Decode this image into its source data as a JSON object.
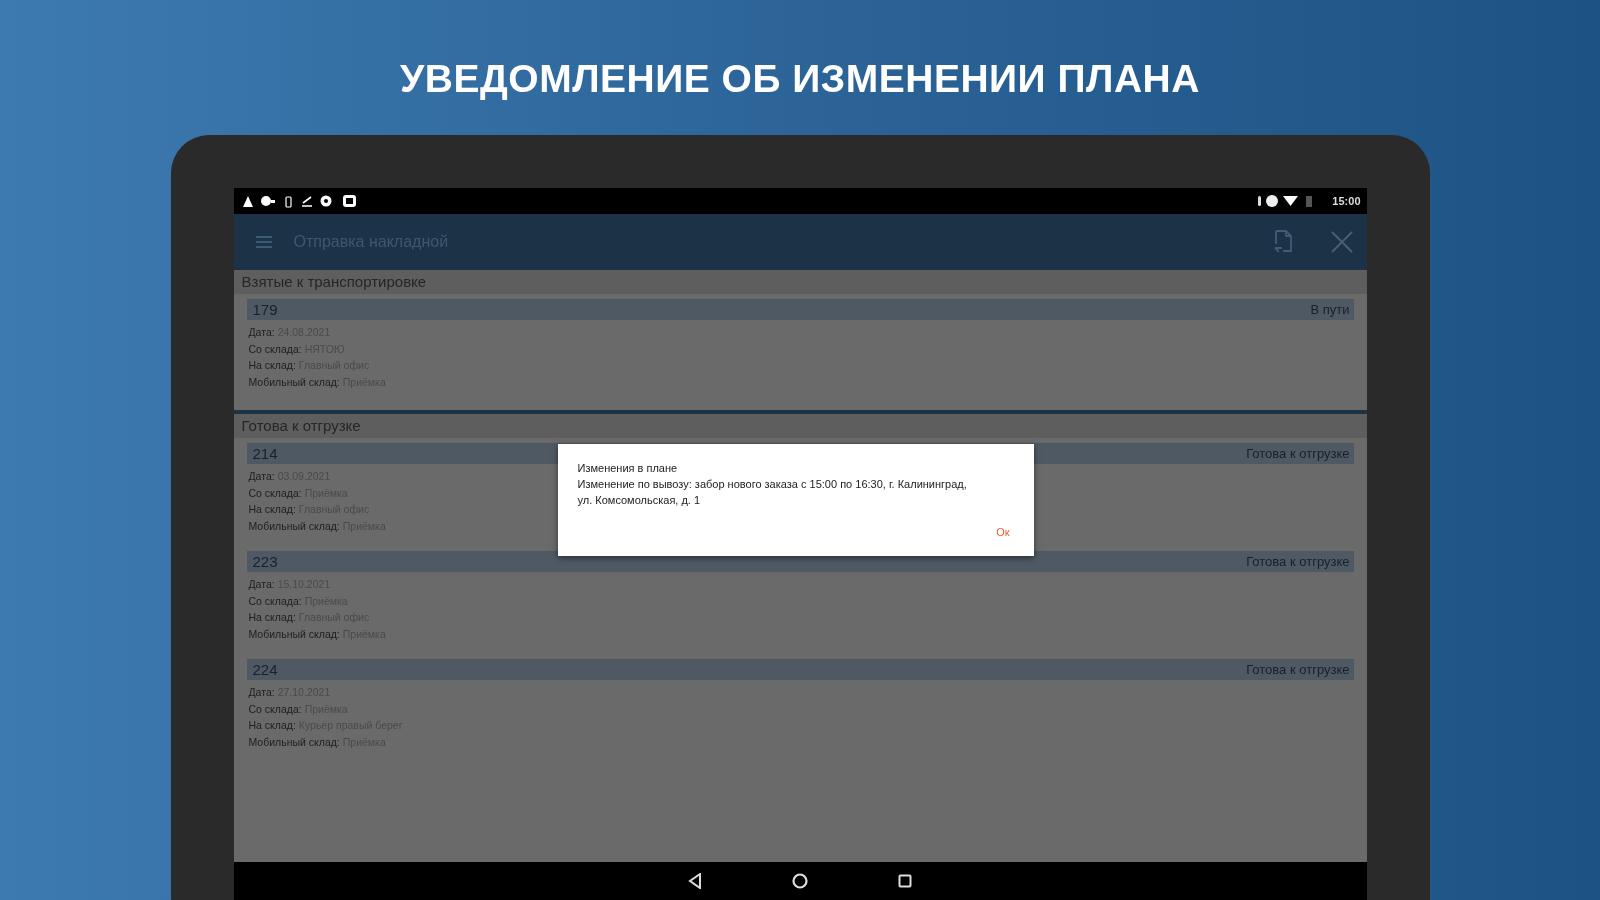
{
  "headline": "УВЕДОМЛЕНИЕ ОБ ИЗМЕНЕНИИ ПЛАНА",
  "status_bar": {
    "time": "15:00"
  },
  "app_bar": {
    "title": "Отправка накладной"
  },
  "sections": [
    {
      "title": "Взятые к транспортировке",
      "orders": [
        {
          "number": "179",
          "status": "В пути",
          "fields": [
            {
              "label": "Дата:",
              "value": "24.08.2021"
            },
            {
              "label": "Со склада:",
              "value": "НЯТОЮ"
            },
            {
              "label": "На склад:",
              "value": "Главный офис"
            },
            {
              "label": "Мобильный склад:",
              "value": "Приёмка"
            }
          ]
        }
      ]
    },
    {
      "title": "Готова к отгрузке",
      "orders": [
        {
          "number": "214",
          "status": "Готова к отгрузке",
          "fields": [
            {
              "label": "Дата:",
              "value": "03.09.2021"
            },
            {
              "label": "Со склада:",
              "value": "Приёмка"
            },
            {
              "label": "На склад:",
              "value": "Главный офис"
            },
            {
              "label": "Мобильный склад:",
              "value": "Приёмка"
            }
          ]
        },
        {
          "number": "223",
          "status": "Готова к отгрузке",
          "fields": [
            {
              "label": "Дата:",
              "value": "15.10.2021"
            },
            {
              "label": "Со склада:",
              "value": "Приёмка"
            },
            {
              "label": "На склад:",
              "value": "Главный офис"
            },
            {
              "label": "Мобильный склад:",
              "value": "Приёмка"
            }
          ]
        },
        {
          "number": "224",
          "status": "Готова к отгрузке",
          "fields": [
            {
              "label": "Дата:",
              "value": "27.10.2021"
            },
            {
              "label": "Со склада:",
              "value": "Приёмка"
            },
            {
              "label": "На склад:",
              "value": "Курьер правый берег"
            },
            {
              "label": "Мобильный склад:",
              "value": "Приёмка"
            }
          ]
        }
      ]
    }
  ],
  "dialog": {
    "title": "Изменения в плане",
    "message": "Изменение по вывозу: забор нового заказа с 15:00 по 16:30, г. Калининград, ул. Комсомольская, д. 1",
    "button": "Ок"
  }
}
